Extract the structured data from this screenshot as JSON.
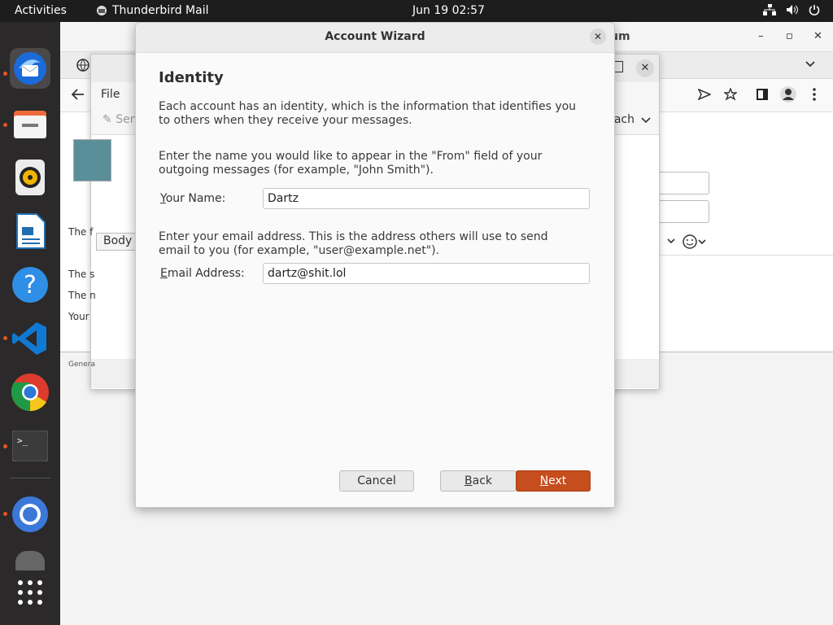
{
  "topbar": {
    "activities": "Activities",
    "app_name": "Thunderbird Mail",
    "clock": "Jun 19  02:57"
  },
  "background_window": {
    "title_fragment": "um",
    "minimize": "–",
    "maximize": "▫",
    "close": "✕"
  },
  "compose": {
    "menu_file": "File",
    "send_fragment": "Sen",
    "attach_fragment": "tach",
    "body_fragment": "Body T",
    "body_lines": [
      "The f",
      "The s",
      "The n",
      "Your "
    ],
    "status_fragment": "Genera"
  },
  "dialog": {
    "title": "Account Wizard",
    "heading": "Identity",
    "intro": "Each account has an identity, which is the information that identifies you to others when they receive your messages.",
    "name_help": "Enter the name you would like to appear in the \"From\" field of your outgoing messages (for example, \"John Smith\").",
    "name_label_accesskey": "Y",
    "name_label_rest": "our Name:",
    "name_value": "Dartz",
    "email_help": "Enter your email address. This is the address others will use to send email to you (for example, \"user@example.net\").",
    "email_label_accesskey": "E",
    "email_label_rest": "mail Address:",
    "email_value": "dartz@shit.lol",
    "cancel_label": "Cancel",
    "back_accesskey": "B",
    "back_rest": "ack",
    "next_accesskey": "N",
    "next_rest": "ext"
  },
  "colors": {
    "accent": "#c64d1d",
    "dock_bg": "#2b2929",
    "topbar_bg": "#1d1d1d"
  },
  "dock": {
    "icons": [
      "thunderbird-icon",
      "files-icon",
      "rhythmbox-icon",
      "libreoffice-writer-icon",
      "help-icon",
      "vscode-icon",
      "chrome-icon",
      "terminal-icon",
      "chromium-icon",
      "drive-icon",
      "app-grid-icon"
    ]
  }
}
